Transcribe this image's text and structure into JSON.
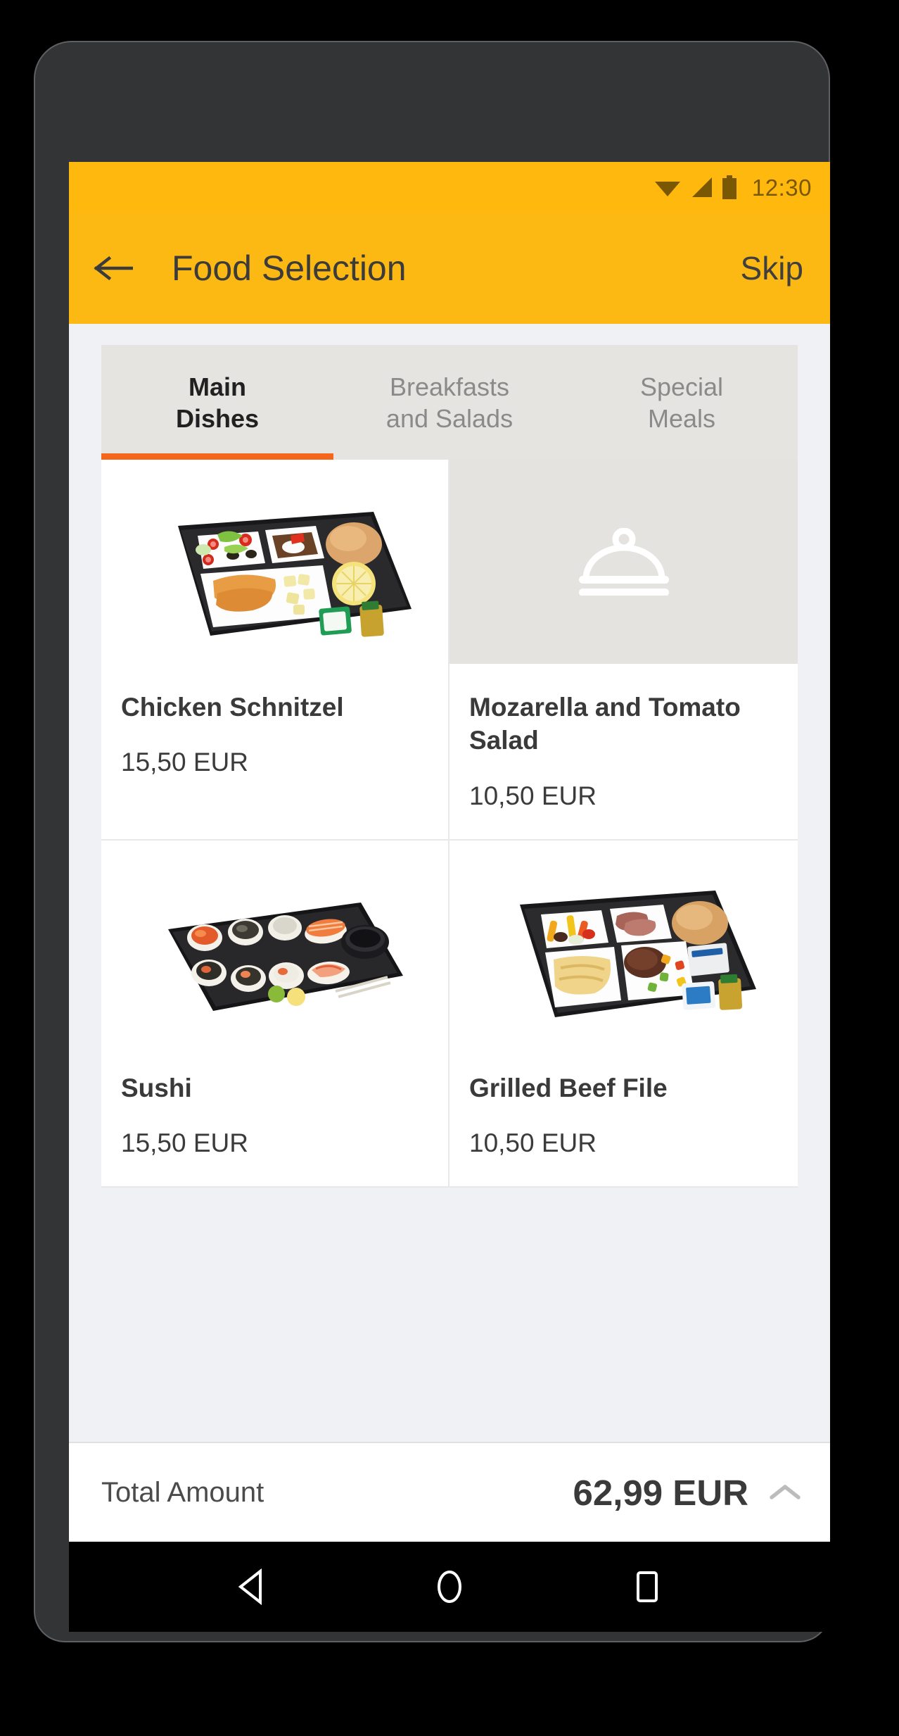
{
  "status_bar": {
    "time": "12:30",
    "icons": [
      "wifi-icon",
      "cellular-signal-icon",
      "battery-icon"
    ],
    "background": "#FFB80D",
    "foreground": "#7a5803"
  },
  "app_bar": {
    "back_icon": "back-arrow-icon",
    "title": "Food Selection",
    "skip_label": "Skip",
    "background": "#FDB913",
    "text_color": "#3b3b3b"
  },
  "tabs": {
    "active_index": 0,
    "accent_color": "#F4661B",
    "items": [
      {
        "label": "Main Dishes",
        "line1": "Main",
        "line2": "Dishes"
      },
      {
        "label": "Breakfasts and Salads",
        "line1": "Breakfasts",
        "line2": "and Salads"
      },
      {
        "label": "Special Meals",
        "line1": "Special",
        "line2": "Meals"
      }
    ]
  },
  "dishes": [
    {
      "name": "Chicken Schnitzel",
      "price": "15,50 EUR",
      "image": "airline-meal-tray-schnitzel-photo",
      "has_image": true
    },
    {
      "name": "Mozarella and Tomato Salad",
      "price": "10,50 EUR",
      "image": "food-cloche-placeholder-icon",
      "has_image": false
    },
    {
      "name": "Sushi",
      "price": "15,50 EUR",
      "image": "sushi-tray-photo",
      "has_image": true
    },
    {
      "name": "Grilled Beef File",
      "price": "10,50 EUR",
      "image": "airline-meal-tray-beef-photo",
      "has_image": true
    }
  ],
  "total": {
    "label": "Total Amount",
    "amount": "62,99 EUR",
    "expand_icon": "chevron-up-icon"
  },
  "nav_bar": {
    "back": "back-triangle-icon",
    "home": "home-circle-icon",
    "recents": "recents-square-icon"
  }
}
